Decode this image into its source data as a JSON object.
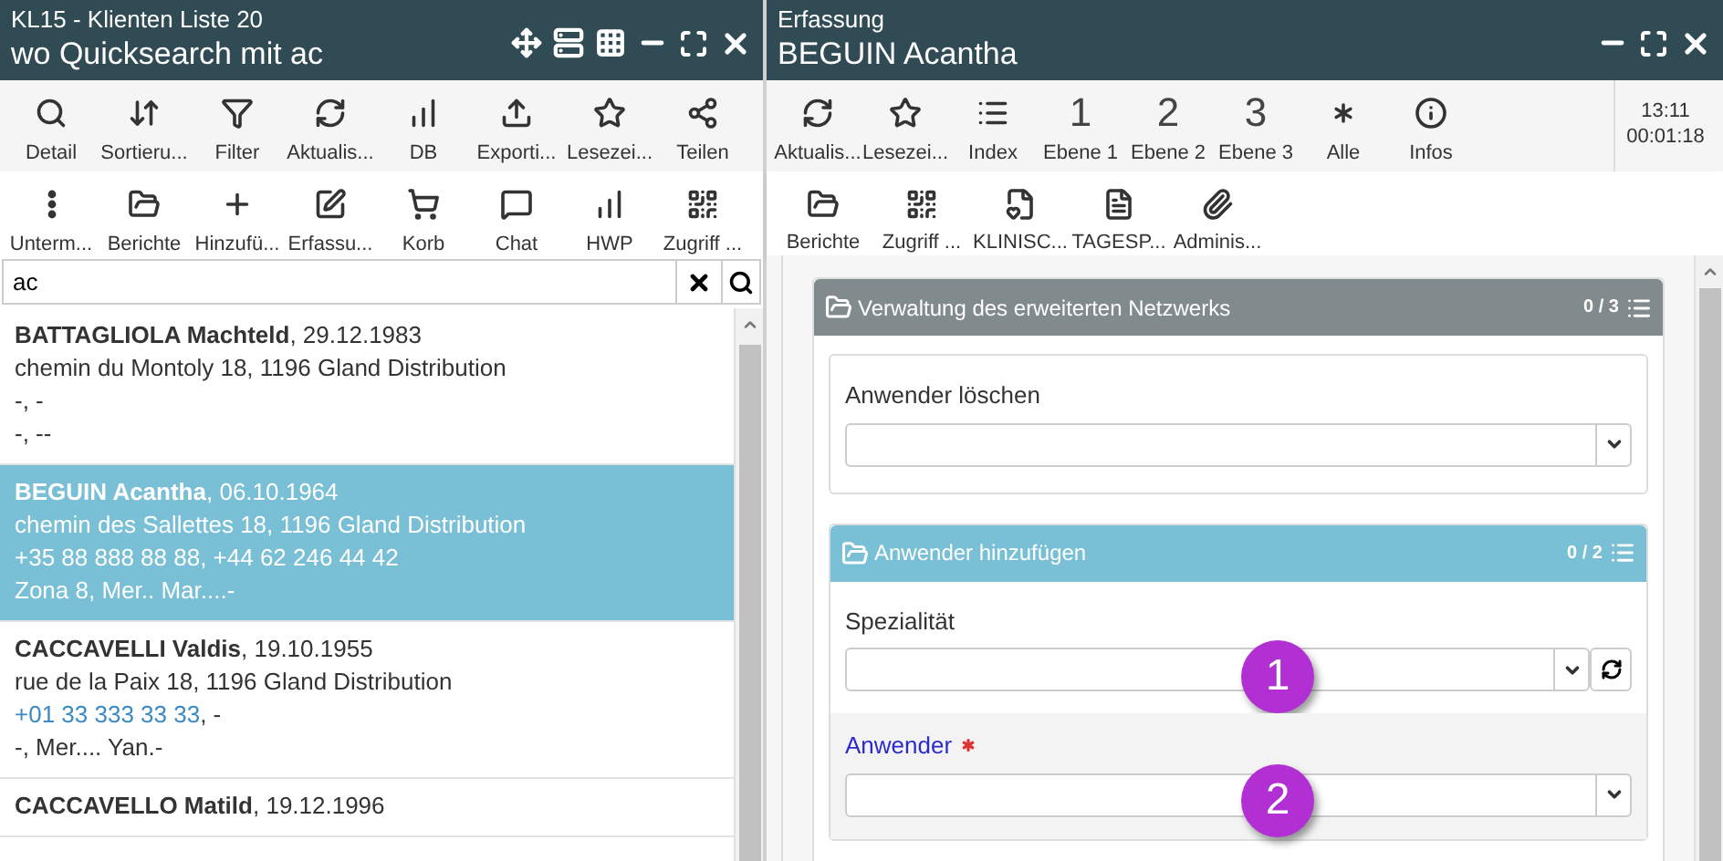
{
  "left": {
    "title": "KL15 - Klienten Liste 20",
    "subtitle": "wo Quicksearch mit ac",
    "toolbar_1": [
      {
        "kind": "icon",
        "label": "Detail"
      },
      {
        "kind": "icon",
        "label": "Sortieru..."
      },
      {
        "kind": "icon",
        "label": "Filter"
      },
      {
        "kind": "icon",
        "label": "Aktualis..."
      },
      {
        "kind": "icon",
        "label": "DB"
      },
      {
        "kind": "icon",
        "label": "Exporti..."
      },
      {
        "kind": "icon",
        "label": "Lesezei..."
      },
      {
        "kind": "icon",
        "label": "Teilen"
      }
    ],
    "toolbar_2": [
      {
        "kind": "icon",
        "label": "Unterm..."
      },
      {
        "kind": "icon",
        "label": "Berichte"
      },
      {
        "kind": "icon",
        "label": "Hinzufü..."
      },
      {
        "kind": "icon",
        "label": "Erfassu..."
      },
      {
        "kind": "icon",
        "label": "Korb"
      },
      {
        "kind": "icon",
        "label": "Chat"
      },
      {
        "kind": "icon",
        "label": "HWP"
      },
      {
        "kind": "icon",
        "label": "Zugriff ..."
      }
    ],
    "search": {
      "value": "ac"
    },
    "clients": [
      {
        "name": "**BATTAGLIOLA Machteld**, 29.12.1983",
        "selected": false,
        "lines": [
          {
            "text": "chemin du Montoly 18, 1196 Gland Distribution"
          },
          {
            "text": "-, -"
          },
          {
            "text": "-, --"
          }
        ]
      },
      {
        "name": "**BEGUIN Acantha**, 06.10.1964",
        "selected": true,
        "lines": [
          {
            "text": "chemin des Sallettes 18, 1196 Gland Distribution"
          },
          {
            "text": "+35 88 888 88 88, +44 62 246 44 42"
          },
          {
            "text": "Zona 8, Mer.. Mar....-"
          }
        ]
      },
      {
        "name": "**CACCAVELLI Valdis**, 19.10.1955",
        "selected": false,
        "lines": [
          {
            "text": "rue de la Paix 18, 1196 Gland Distribution"
          },
          {
            "link": "+01 33 333 33 33",
            "text": ", -"
          },
          {
            "text": "-, Mer.... Yan.-"
          }
        ]
      },
      {
        "name": "**CACCAVELLO Matild**, 19.12.1996",
        "selected": false
      }
    ]
  },
  "right": {
    "title": "Erfassung",
    "subtitle": "BEGUIN Acantha",
    "toolbar_1": [
      {
        "kind": "icon",
        "label": "Aktualis..."
      },
      {
        "kind": "icon",
        "label": "Lesezei..."
      },
      {
        "kind": "icon",
        "label": "Index"
      },
      {
        "kind": "glyph",
        "glyph": "1",
        "label": "Ebene 1"
      },
      {
        "kind": "glyph",
        "glyph": "2",
        "label": "Ebene 2"
      },
      {
        "kind": "glyph",
        "glyph": "3",
        "label": "Ebene 3"
      },
      {
        "kind": "icon",
        "label": "Alle"
      },
      {
        "kind": "icon",
        "label": "Infos"
      }
    ],
    "clock": {
      "time": "13:11",
      "elapsed": "00:01:18"
    },
    "toolbar_2": [
      {
        "kind": "icon",
        "label": "Berichte"
      },
      {
        "kind": "icon",
        "label": "Zugriff ..."
      },
      {
        "kind": "icon",
        "label": "KLINISC..."
      },
      {
        "kind": "icon",
        "label": "TAGESP..."
      },
      {
        "kind": "icon",
        "label": "Adminis..."
      }
    ],
    "sections": [
      {
        "title": "Verwaltung des erweiterten Netzwerks",
        "count": "0 / 3",
        "kind": "group",
        "fields": [
          {
            "label": "Anwender löschen",
            "kind": "select",
            "required": false,
            "active": false
          }
        ]
      },
      {
        "title": "Anwender hinzufügen",
        "count": "0 / 2",
        "kind": "subgroup",
        "fields": [
          {
            "label": "Spezialität",
            "kind": "select_refresh",
            "required": false,
            "active": false,
            "marker": "1"
          },
          {
            "label": "Anwender",
            "kind": "select",
            "required": true,
            "active": true,
            "marker": "2"
          }
        ]
      }
    ]
  }
}
